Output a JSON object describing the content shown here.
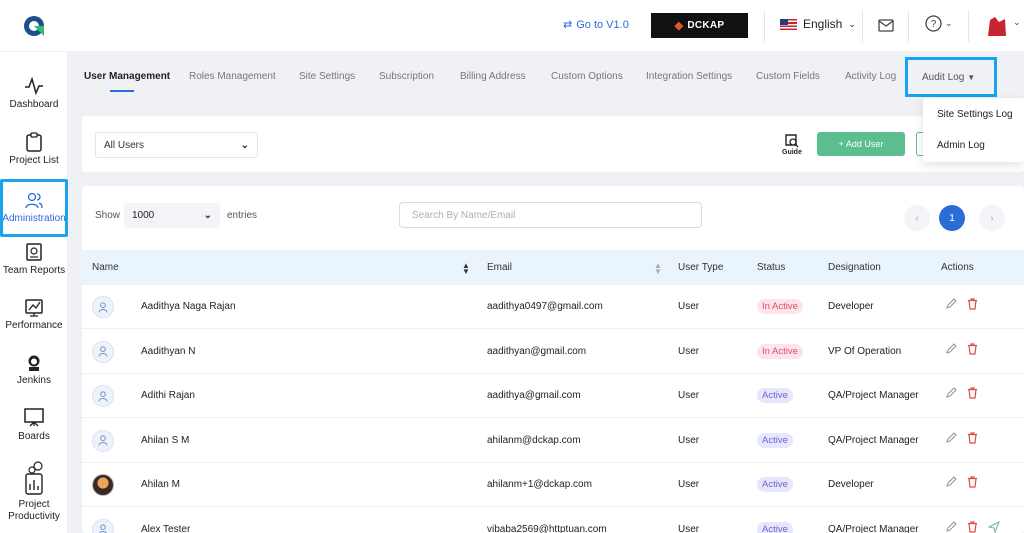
{
  "topbar": {
    "goto_label": "Go to V1.0",
    "brand_label": "DCKAP",
    "language": "English"
  },
  "sidebar": {
    "items": [
      {
        "label": "Dashboard",
        "icon": "pulse-icon"
      },
      {
        "label": "Project List",
        "icon": "clipboard-icon"
      },
      {
        "label": "Administration",
        "icon": "users-icon"
      },
      {
        "label": "Team Reports",
        "icon": "report-icon"
      },
      {
        "label": "Performance",
        "icon": "performance-icon"
      },
      {
        "label": "Jenkins",
        "icon": "jenkins-icon"
      },
      {
        "label": "Boards",
        "icon": "board-icon"
      },
      {
        "label": "Project Productivity",
        "icon": "productivity-icon"
      }
    ]
  },
  "tabs": [
    "User Management",
    "Roles Management",
    "Site Settings",
    "Subscription",
    "Billing Address",
    "Custom Options",
    "Integration Settings",
    "Custom Fields",
    "Activity Log",
    "Audit Log"
  ],
  "audit_dropdown": [
    "Site Settings Log",
    "Admin Log"
  ],
  "filter": {
    "user_filter": "All Users",
    "guide_label": "Guide",
    "add_user_label": "+ Add User"
  },
  "table": {
    "show_label": "Show",
    "entries_value": "1000",
    "entries_label": "entries",
    "search_placeholder": "Search By Name/Email",
    "current_page": "1",
    "columns": [
      "Name",
      "Email",
      "User Type",
      "Status",
      "Designation",
      "Actions"
    ],
    "rows": [
      {
        "name": "Aadithya Naga Rajan",
        "email": "aadithya0497@gmail.com",
        "type": "User",
        "status": "In Active",
        "designation": "Developer"
      },
      {
        "name": "Aadithyan N",
        "email": "aadithyan@gmail.com",
        "type": "User",
        "status": "In Active",
        "designation": "VP Of Operation"
      },
      {
        "name": "Adithi Rajan",
        "email": "aadithya@gmail.com",
        "type": "User",
        "status": "Active",
        "designation": "QA/Project Manager"
      },
      {
        "name": "Ahilan S M",
        "email": "ahilanm@dckap.com",
        "type": "User",
        "status": "Active",
        "designation": "QA/Project Manager"
      },
      {
        "name": "Ahilan M",
        "email": "ahilanm+1@dckap.com",
        "type": "User",
        "status": "Active",
        "designation": "Developer"
      },
      {
        "name": "Alex Tester",
        "email": "vibaba2569@httptuan.com",
        "type": "User",
        "status": "Active",
        "designation": "QA/Project Manager"
      }
    ]
  },
  "colors": {
    "accent": "#2b6cd6",
    "highlight": "#1aa3ef",
    "add_button": "#5cbd8e",
    "danger": "#e14b4b"
  }
}
